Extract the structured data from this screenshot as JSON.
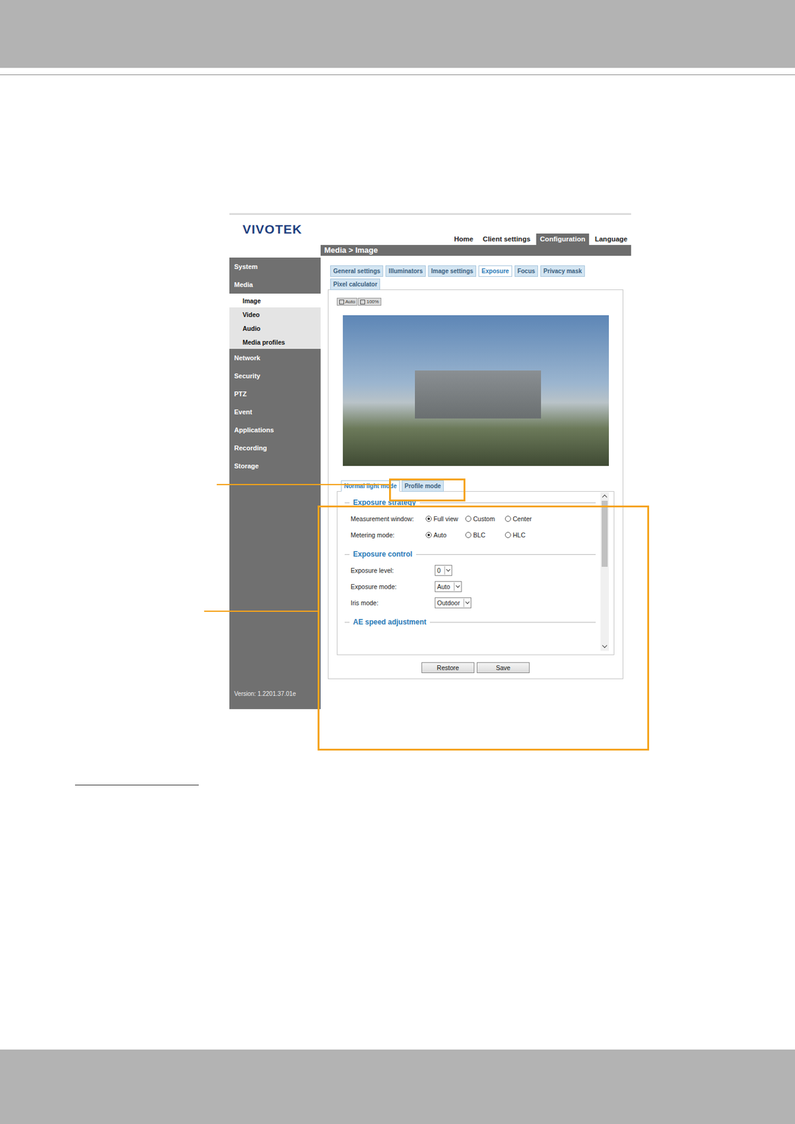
{
  "brand": "VIVOTEK",
  "nav": [
    {
      "label": "Home",
      "selected": false
    },
    {
      "label": "Client settings",
      "selected": false
    },
    {
      "label": "Configuration",
      "selected": true
    },
    {
      "label": "Language",
      "selected": false
    }
  ],
  "breadcrumb": "Media > Image",
  "sidebar": {
    "items": [
      {
        "label": "System",
        "expanded": false,
        "children": []
      },
      {
        "label": "Media",
        "expanded": true,
        "children": [
          {
            "label": "Image",
            "selected": true
          },
          {
            "label": "Video",
            "selected": false
          },
          {
            "label": "Audio",
            "selected": false
          },
          {
            "label": "Media profiles",
            "selected": false
          }
        ]
      },
      {
        "label": "Network",
        "expanded": false,
        "children": []
      },
      {
        "label": "Security",
        "expanded": false,
        "children": []
      },
      {
        "label": "PTZ",
        "expanded": false,
        "children": []
      },
      {
        "label": "Event",
        "expanded": false,
        "children": []
      },
      {
        "label": "Applications",
        "expanded": false,
        "children": []
      },
      {
        "label": "Recording",
        "expanded": false,
        "children": []
      },
      {
        "label": "Storage",
        "expanded": false,
        "children": []
      }
    ],
    "version": "Version: 1.2201.37.01e"
  },
  "subtabs": [
    {
      "label": "General settings",
      "selected": false
    },
    {
      "label": "Illuminators",
      "selected": false
    },
    {
      "label": "Image settings",
      "selected": false
    },
    {
      "label": "Exposure",
      "selected": true
    },
    {
      "label": "Focus",
      "selected": false
    },
    {
      "label": "Privacy mask",
      "selected": false
    },
    {
      "label": "Pixel calculator",
      "selected": false
    }
  ],
  "view_buttons": [
    "Auto",
    "100%"
  ],
  "mode_tabs": [
    {
      "label": "Normal light mode",
      "selected": true
    },
    {
      "label": "Profile mode",
      "selected": false
    }
  ],
  "sections": [
    {
      "title": "Exposure strategy",
      "rows": [
        {
          "kind": "radio",
          "label": "Measurement window:",
          "value": "",
          "options": [
            {
              "label": "Full view",
              "selected": true
            },
            {
              "label": "Custom",
              "selected": false
            },
            {
              "label": "Center",
              "selected": false
            }
          ]
        },
        {
          "kind": "radio",
          "label": "Metering mode:",
          "value": "",
          "options": [
            {
              "label": "Auto",
              "selected": true
            },
            {
              "label": "BLC",
              "selected": false
            },
            {
              "label": "HLC",
              "selected": false
            }
          ]
        }
      ]
    },
    {
      "title": "Exposure control",
      "rows": [
        {
          "kind": "select",
          "label": "Exposure level:",
          "value": "0",
          "options": []
        },
        {
          "kind": "select",
          "label": "Exposure mode:",
          "value": "Auto",
          "options": []
        },
        {
          "kind": "select",
          "label": "Iris mode:",
          "value": "Outdoor",
          "options": []
        }
      ]
    },
    {
      "title": "AE speed adjustment",
      "rows": []
    }
  ],
  "buttons": [
    "Restore",
    "Save"
  ]
}
